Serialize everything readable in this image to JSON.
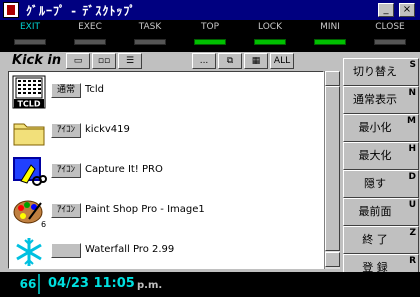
{
  "window": {
    "title": "ｸﾞﾙｰﾌﾟ - ﾃﾞｽｸﾄｯﾌﾟ",
    "minimize": "_",
    "close": "×"
  },
  "commands": [
    {
      "label": "EXIT",
      "color": "#00d0d0",
      "lamp": false
    },
    {
      "label": "EXEC",
      "color": "#c8c8c8",
      "lamp": false
    },
    {
      "label": "TASK",
      "color": "#c8c8c8",
      "lamp": false
    },
    {
      "label": "TOP",
      "color": "#c8c8c8",
      "lamp": true
    },
    {
      "label": "LOCK",
      "color": "#c8c8c8",
      "lamp": true
    },
    {
      "label": "MINI",
      "color": "#c8c8c8",
      "lamp": true
    },
    {
      "label": "CLOSE",
      "color": "#c8c8c8",
      "lamp": false
    }
  ],
  "toolbar": {
    "label": "Kick in",
    "tools": [
      {
        "name": "tool-large-icon",
        "text": "▭"
      },
      {
        "name": "tool-small-icon",
        "text": "▫▫"
      },
      {
        "name": "tool-list-view",
        "text": "☰"
      },
      {
        "name": "tool-more",
        "text": "..."
      },
      {
        "name": "tool-windows",
        "text": "⧉"
      },
      {
        "name": "tool-grid",
        "text": "▦"
      },
      {
        "name": "tool-all",
        "text": "ALL"
      }
    ]
  },
  "list": [
    {
      "badge": "通常",
      "name": "Tcld",
      "icon": "tcld"
    },
    {
      "badge": "ｱｲｺﾝ",
      "name": "kickv419",
      "icon": "folder"
    },
    {
      "badge": "ｱｲｺﾝ",
      "name": "Capture It! PRO",
      "icon": "capture"
    },
    {
      "badge": "ｱｲｺﾝ",
      "name": "Paint Shop Pro - Image1",
      "icon": "paint"
    },
    {
      "badge": "",
      "name": "Waterfall Pro 2.99",
      "icon": "snowflake"
    }
  ],
  "icon_labels": {
    "tcld": "TCLD",
    "paint_sub": "6"
  },
  "actions": [
    {
      "label": "切り替え",
      "key": "S"
    },
    {
      "label": "通常表示",
      "key": "N"
    },
    {
      "label": "最小化",
      "key": "M"
    },
    {
      "label": "最大化",
      "key": "H"
    },
    {
      "label": "隠す",
      "key": "D"
    },
    {
      "label": "最前面",
      "key": "U"
    },
    {
      "label": "終 了",
      "key": "Z"
    },
    {
      "label": "登 録",
      "key": "R"
    }
  ],
  "status": {
    "count": "66",
    "datetime": "04/23 11:05",
    "ampm": "p.m."
  }
}
